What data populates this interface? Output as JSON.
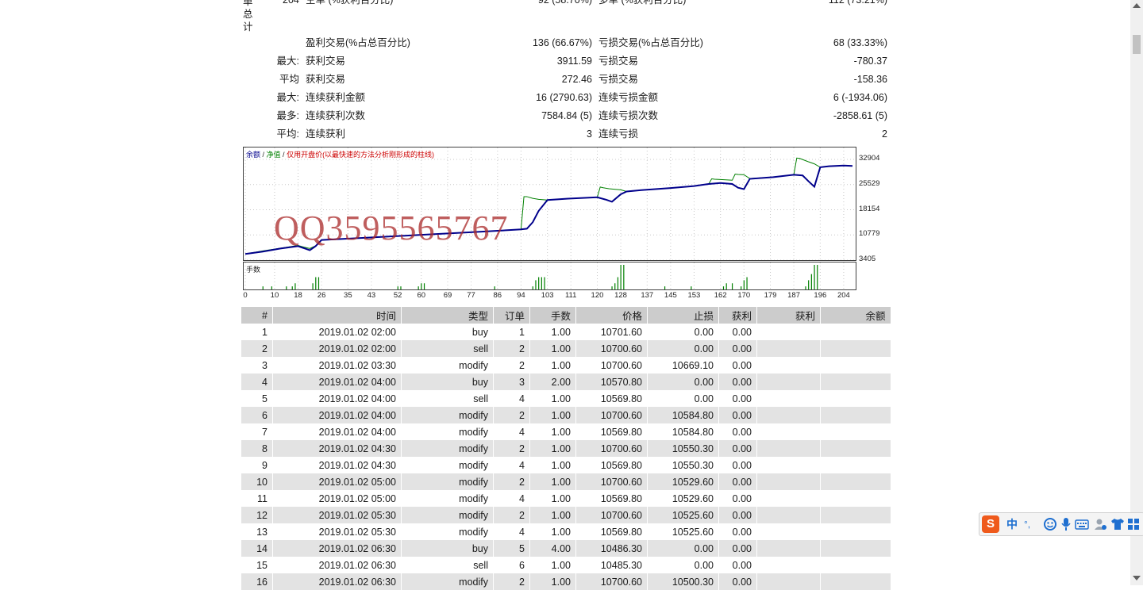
{
  "colors": {
    "balance_line": "#00008b",
    "equity_line": "#008000",
    "volume_bar": "#008000",
    "header_bg": "#cccccc",
    "row_even_bg": "#e3e3e3",
    "watermark": "#aa2828"
  },
  "stats": {
    "side_label_chars": [
      "单",
      "总",
      "计"
    ],
    "top_row": {
      "left_value": "204",
      "left_label": "空单 (%获利百分比)",
      "mid_value": "92 (58.70%)",
      "right_label": "多单 (%获利百分比)",
      "right_value": "112 (73.21%)"
    },
    "rows": [
      {
        "prefix": "",
        "label": "盈利交易(%占总百分比)",
        "value": "136 (66.67%)",
        "label2": "亏损交易(%占总百分比)",
        "value2": "68 (33.33%)"
      },
      {
        "prefix": "最大:",
        "label": "获利交易",
        "value": "3911.59",
        "label2": "亏损交易",
        "value2": "-780.37"
      },
      {
        "prefix": "平均",
        "label": "获利交易",
        "value": "272.46",
        "label2": "亏损交易",
        "value2": "-158.36"
      },
      {
        "prefix": "最大:",
        "label": "连续获利金额",
        "value": "16 (2790.63)",
        "label2": "连续亏损金额",
        "value2": "6 (-1934.06)"
      },
      {
        "prefix": "最多:",
        "label": "连续获利次数",
        "value": "7584.84 (5)",
        "label2": "连续亏损次数",
        "value2": "-2858.61 (5)"
      },
      {
        "prefix": "平均:",
        "label": "连续获利",
        "value": "3",
        "label2": "连续亏损",
        "value2": "2"
      }
    ]
  },
  "chart": {
    "legend_balance": "余额",
    "legend_sep1": " / ",
    "legend_equity": "净值",
    "legend_sep2": " / ",
    "legend_note": "仅用开盘价(以最快速的方法分析刚形成的柱线)",
    "volume_label": "手数",
    "watermark": "QQ3595565767"
  },
  "chart_data": {
    "type": "line",
    "x_ticks": [
      0,
      10,
      18,
      26,
      35,
      43,
      52,
      60,
      69,
      77,
      86,
      94,
      103,
      111,
      120,
      128,
      137,
      145,
      153,
      162,
      170,
      179,
      187,
      196,
      204
    ],
    "y_ticks": [
      32904,
      25529,
      18154,
      10779,
      3405
    ],
    "xlim": [
      0,
      207
    ],
    "ylim": [
      3405,
      32904
    ],
    "series": [
      {
        "name": "余额",
        "x": [
          0,
          6,
          12,
          18,
          20,
          22,
          24,
          26,
          40,
          60,
          80,
          90,
          94,
          96,
          98,
          100,
          103,
          110,
          120,
          123,
          125,
          128,
          130,
          135,
          145,
          153,
          158,
          162,
          166,
          168,
          170,
          172,
          180,
          187,
          190,
          192,
          194,
          196,
          199,
          204,
          207
        ],
        "y": [
          5200,
          5900,
          6800,
          7500,
          6900,
          6300,
          7500,
          9300,
          9900,
          10800,
          11700,
          12200,
          12400,
          12600,
          14500,
          17800,
          21000,
          21400,
          21800,
          21100,
          20500,
          22700,
          23500,
          23900,
          24500,
          25100,
          25700,
          26000,
          25700,
          24600,
          24200,
          27200,
          27700,
          28400,
          28200,
          26500,
          24900,
          30600,
          30900,
          31100,
          31000
        ]
      },
      {
        "name": "净值",
        "x": [
          0,
          6,
          12,
          18,
          20,
          22,
          24,
          26,
          40,
          60,
          80,
          90,
          94,
          95,
          96,
          98,
          100,
          103,
          110,
          120,
          121,
          122,
          124,
          128,
          130,
          135,
          145,
          153,
          158,
          159,
          160,
          162,
          166,
          167,
          168,
          170,
          172,
          180,
          187,
          188,
          189,
          192,
          194,
          196,
          199,
          204,
          207
        ],
        "y": [
          5200,
          6100,
          6900,
          7700,
          7200,
          6800,
          7600,
          9300,
          9900,
          10800,
          11700,
          12200,
          12400,
          22000,
          22000,
          21500,
          21200,
          21000,
          21400,
          21800,
          24800,
          24600,
          24300,
          24000,
          23500,
          23900,
          24500,
          25100,
          25700,
          27200,
          27100,
          27000,
          26800,
          28600,
          28500,
          28400,
          27300,
          27700,
          28400,
          33300,
          33200,
          32200,
          31600,
          30600,
          30900,
          31100,
          31000
        ]
      }
    ],
    "volume": {
      "x": [
        6,
        9,
        14,
        16,
        17,
        23,
        24,
        25,
        52,
        53,
        59,
        60,
        61,
        85,
        98,
        99,
        100,
        101,
        102,
        125,
        126,
        127,
        128,
        129,
        143,
        152,
        163,
        164,
        166,
        169,
        170,
        171,
        191,
        192,
        193,
        194,
        195
      ],
      "y": [
        1,
        1,
        1,
        1,
        2,
        2,
        4,
        4,
        1,
        1,
        1,
        2,
        2,
        1,
        1,
        3,
        4,
        4,
        4,
        1,
        2,
        4,
        8,
        8,
        1,
        1,
        1,
        2,
        2,
        1,
        3,
        4,
        1,
        3,
        5,
        8,
        8
      ],
      "ymax": 8
    }
  },
  "table": {
    "headers": [
      "#",
      "时间",
      "类型",
      "订单",
      "手数",
      "价格",
      "止损",
      "获利",
      "获利",
      "余额"
    ],
    "rows": [
      [
        "1",
        "2019.01.02 02:00",
        "buy",
        "1",
        "1.00",
        "10701.60",
        "0.00",
        "0.00",
        "",
        ""
      ],
      [
        "2",
        "2019.01.02 02:00",
        "sell",
        "2",
        "1.00",
        "10700.60",
        "0.00",
        "0.00",
        "",
        ""
      ],
      [
        "3",
        "2019.01.02 03:30",
        "modify",
        "2",
        "1.00",
        "10700.60",
        "10669.10",
        "0.00",
        "",
        ""
      ],
      [
        "4",
        "2019.01.02 04:00",
        "buy",
        "3",
        "2.00",
        "10570.80",
        "0.00",
        "0.00",
        "",
        ""
      ],
      [
        "5",
        "2019.01.02 04:00",
        "sell",
        "4",
        "1.00",
        "10569.80",
        "0.00",
        "0.00",
        "",
        ""
      ],
      [
        "6",
        "2019.01.02 04:00",
        "modify",
        "2",
        "1.00",
        "10700.60",
        "10584.80",
        "0.00",
        "",
        ""
      ],
      [
        "7",
        "2019.01.02 04:00",
        "modify",
        "4",
        "1.00",
        "10569.80",
        "10584.80",
        "0.00",
        "",
        ""
      ],
      [
        "8",
        "2019.01.02 04:30",
        "modify",
        "2",
        "1.00",
        "10700.60",
        "10550.30",
        "0.00",
        "",
        ""
      ],
      [
        "9",
        "2019.01.02 04:30",
        "modify",
        "4",
        "1.00",
        "10569.80",
        "10550.30",
        "0.00",
        "",
        ""
      ],
      [
        "10",
        "2019.01.02 05:00",
        "modify",
        "2",
        "1.00",
        "10700.60",
        "10529.60",
        "0.00",
        "",
        ""
      ],
      [
        "11",
        "2019.01.02 05:00",
        "modify",
        "4",
        "1.00",
        "10569.80",
        "10529.60",
        "0.00",
        "",
        ""
      ],
      [
        "12",
        "2019.01.02 05:30",
        "modify",
        "2",
        "1.00",
        "10700.60",
        "10525.60",
        "0.00",
        "",
        ""
      ],
      [
        "13",
        "2019.01.02 05:30",
        "modify",
        "4",
        "1.00",
        "10569.80",
        "10525.60",
        "0.00",
        "",
        ""
      ],
      [
        "14",
        "2019.01.02 06:30",
        "buy",
        "5",
        "4.00",
        "10486.30",
        "0.00",
        "0.00",
        "",
        ""
      ],
      [
        "15",
        "2019.01.02 06:30",
        "sell",
        "6",
        "1.00",
        "10485.30",
        "0.00",
        "0.00",
        "",
        ""
      ],
      [
        "16",
        "2019.01.02 06:30",
        "modify",
        "2",
        "1.00",
        "10700.60",
        "10500.30",
        "0.00",
        "",
        ""
      ]
    ]
  },
  "ime": {
    "logo": "S",
    "lang": "中",
    "punct": "°,",
    "icons": [
      "smiley-icon",
      "microphone-icon",
      "keyboard-icon",
      "user-icon",
      "shirt-icon",
      "grid-icon"
    ]
  }
}
